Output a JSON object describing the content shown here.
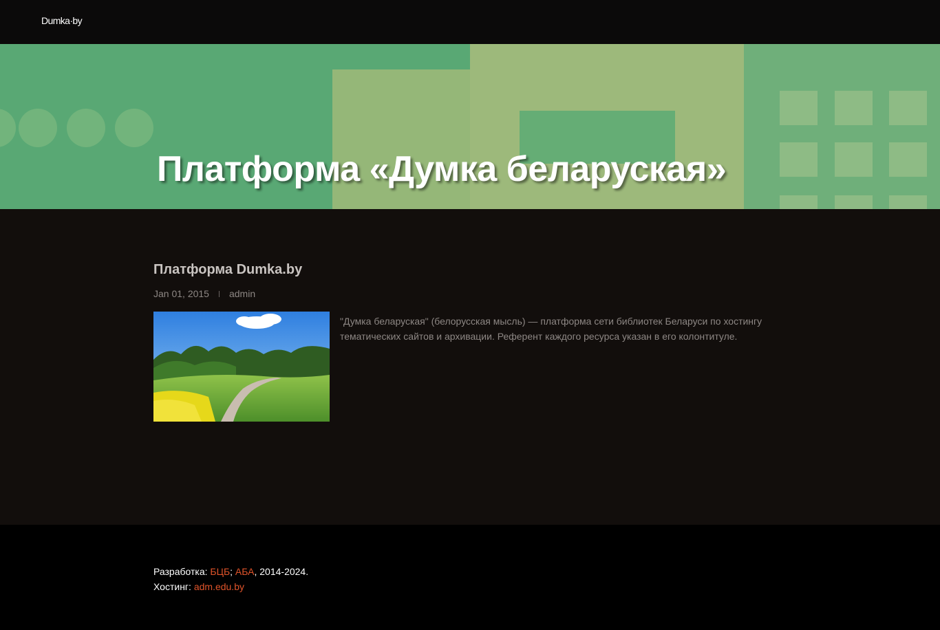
{
  "header": {
    "logo": "Dumka·by"
  },
  "hero": {
    "title": "Платформа «Думка беларуская»"
  },
  "post": {
    "title": "Платформа Dumka.by",
    "date": "Jan 01, 2015",
    "author": "admin",
    "excerpt": "\"Думка беларуская\" (белорусская мысль) — платформа сети библиотек Беларуси по хостингу тематических сайтов и архивации. Референт каждого ресурса указан в его колонтитуле."
  },
  "footer": {
    "dev_prefix": "Разработка: ",
    "dev_link1": "БЦБ",
    "dev_sep": ";",
    "dev_link2": "АБА",
    "dev_suffix": ", 2014-2024.",
    "hosting_prefix": "Хостинг: ",
    "hosting_link": "adm.edu.by"
  },
  "colors": {
    "topbar": "#0b0a0a",
    "hero_green": "#5fae78",
    "main_bg": "#120e0c",
    "link": "#e0542a"
  }
}
